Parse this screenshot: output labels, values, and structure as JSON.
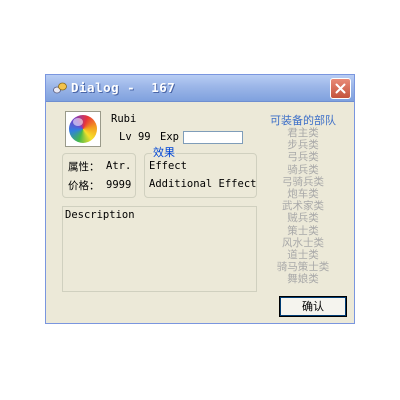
{
  "window": {
    "title": "Dialog -  167"
  },
  "character": {
    "name": "Rubi",
    "level_label": "Lv 99",
    "exp_label": "Exp",
    "exp_value": ""
  },
  "stats": {
    "attr_label": "属性：",
    "attr_value": "Atr.",
    "price_label": "价格：",
    "price_value": "9999"
  },
  "effect": {
    "legend": "效果",
    "line1": "Effect",
    "line2": "Additional Effect"
  },
  "description": {
    "text": "Description"
  },
  "units": {
    "title": "可装备的部队",
    "items": [
      "君主类",
      "步兵类",
      "弓兵类",
      "骑兵类",
      "弓骑兵类",
      "炮车类",
      "武术家类",
      "贼兵类",
      "策士类",
      "风水士类",
      "道士类",
      "骑马策士类",
      "舞娘类"
    ]
  },
  "buttons": {
    "ok": "确认"
  },
  "icons": {
    "window": "dialog-icon",
    "close": "close-icon",
    "avatar": "color-orb-icon"
  },
  "colors": {
    "title_gradient_top": "#b8cdf4",
    "close_red": "#c4523b",
    "legend_blue": "#0046d5",
    "disabled_gray": "#a9a9a9"
  }
}
